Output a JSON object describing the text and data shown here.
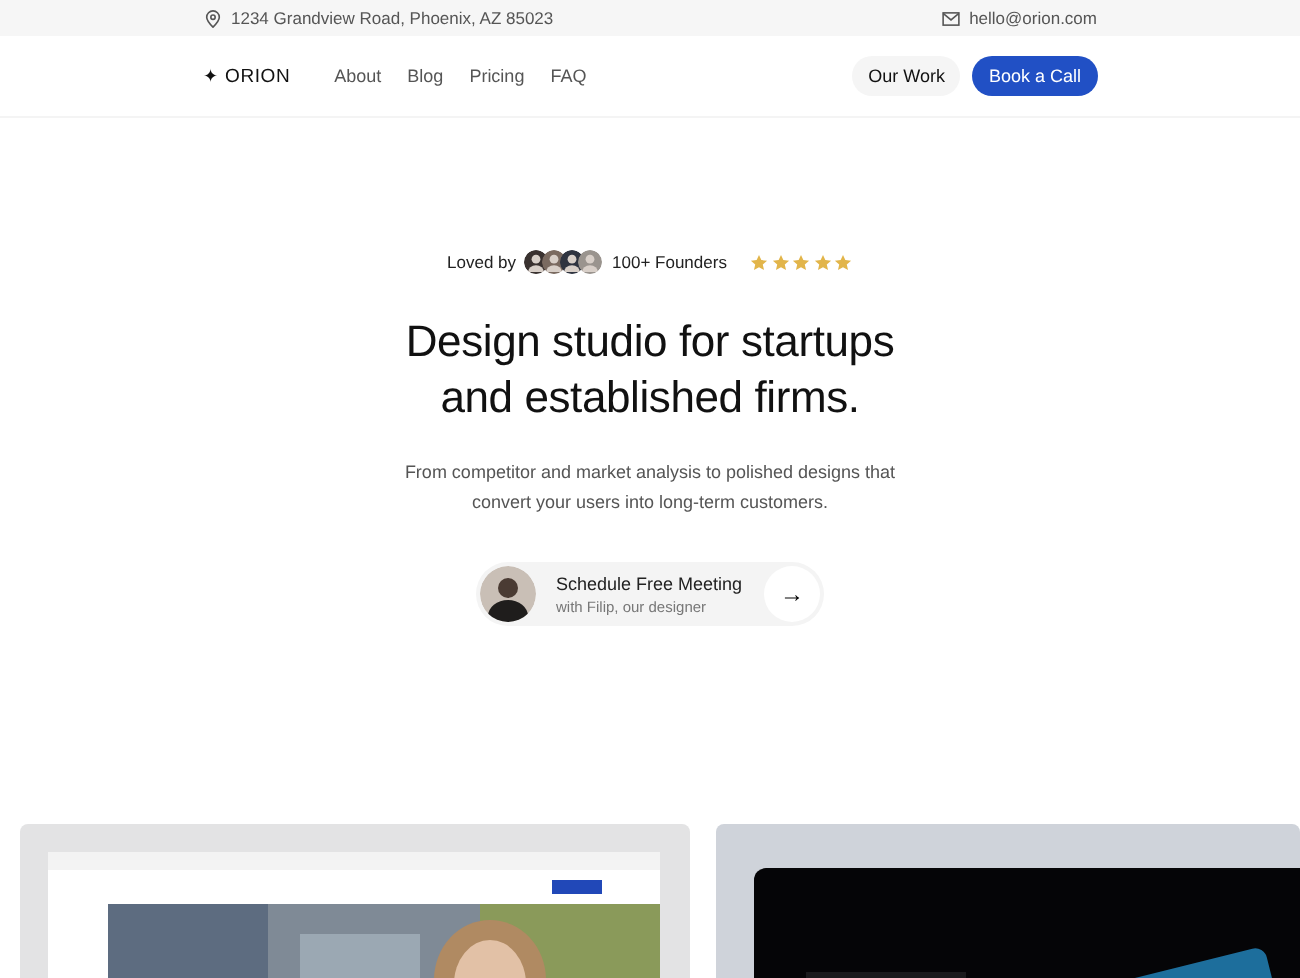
{
  "top_bar": {
    "address": "1234 Grandview Road, Phoenix, AZ 85023",
    "email": "hello@orion.com"
  },
  "nav": {
    "logo_mark": "✦",
    "logo": "ORION",
    "links": [
      "About",
      "Blog",
      "Pricing",
      "FAQ"
    ],
    "secondary_button": "Our Work",
    "primary_button": "Book a Call"
  },
  "hero": {
    "loved_by": "Loved by",
    "founders": "100+ Founders",
    "stars": 5,
    "title_lines": [
      "Design studio for startups",
      "and established firms."
    ],
    "subtitle_lines": [
      "From competitor and market analysis to polished designs that",
      "convert your users into long-term customers."
    ],
    "cta": {
      "title": "Schedule Free Meeting",
      "subtitle": "with Filip, our designer",
      "arrow": "→"
    }
  }
}
